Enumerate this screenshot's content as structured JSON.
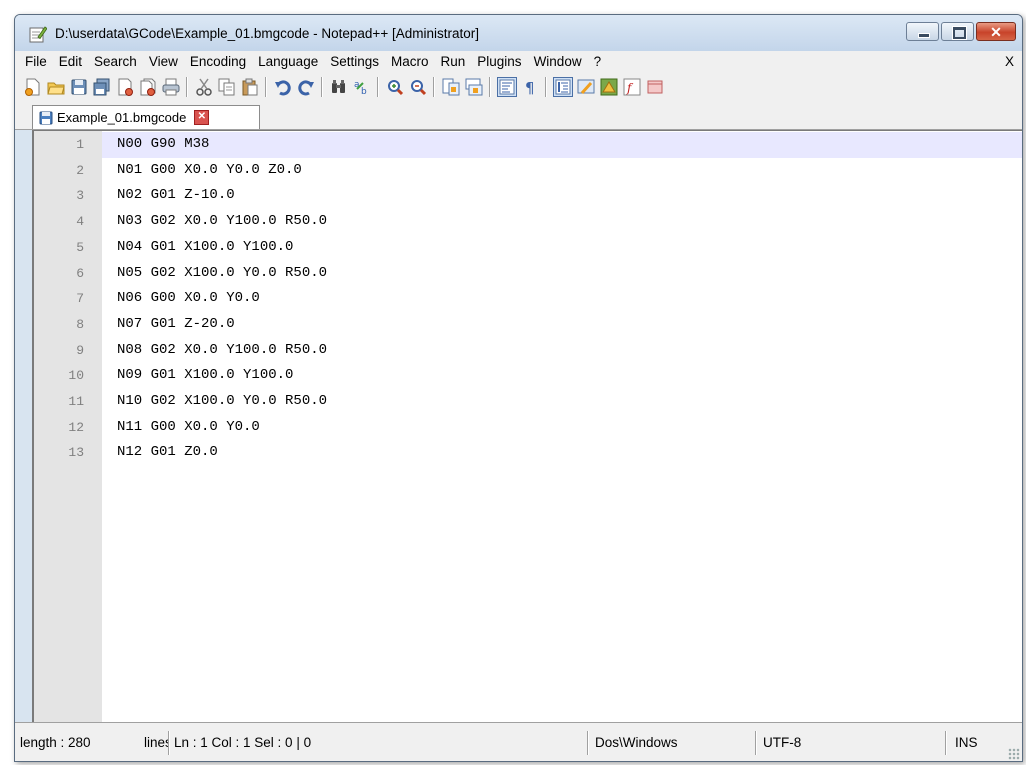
{
  "window": {
    "title": "D:\\userdata\\GCode\\Example_01.bmgcode - Notepad++ [Administrator]"
  },
  "menu": {
    "items": [
      "File",
      "Edit",
      "Search",
      "View",
      "Encoding",
      "Language",
      "Settings",
      "Macro",
      "Run",
      "Plugins",
      "Window",
      "?"
    ],
    "close_label": "X"
  },
  "toolbar": {
    "icons": [
      "new-file-icon",
      "open-file-icon",
      "save-icon",
      "save-all-icon",
      "close-icon",
      "close-all-icon",
      "print-icon",
      "cut-icon",
      "copy-icon",
      "paste-icon",
      "undo-icon",
      "redo-icon",
      "find-icon",
      "replace-icon",
      "zoom-in-icon",
      "zoom-out-icon",
      "sync-vertical-icon",
      "sync-horizontal-icon",
      "word-wrap-icon",
      "show-all-chars-icon",
      "indent-guide-icon",
      "user-language-icon",
      "doc-map-icon",
      "function-list-icon",
      "folder-workspace-icon"
    ]
  },
  "tab": {
    "label": "Example_01.bmgcode",
    "close_glyph": "✕"
  },
  "editor": {
    "lines": [
      {
        "num": "1",
        "text": "N00 G90 M38"
      },
      {
        "num": "2",
        "text": "N01 G00 X0.0 Y0.0 Z0.0"
      },
      {
        "num": "3",
        "text": "N02 G01 Z-10.0"
      },
      {
        "num": "4",
        "text": "N03 G02 X0.0 Y100.0 R50.0"
      },
      {
        "num": "5",
        "text": "N04 G01 X100.0 Y100.0"
      },
      {
        "num": "6",
        "text": "N05 G02 X100.0 Y0.0 R50.0"
      },
      {
        "num": "7",
        "text": "N06 G00 X0.0 Y0.0"
      },
      {
        "num": "8",
        "text": "N07 G01 Z-20.0"
      },
      {
        "num": "9",
        "text": "N08 G02 X0.0 Y100.0 R50.0"
      },
      {
        "num": "10",
        "text": "N09 G01 X100.0 Y100.0"
      },
      {
        "num": "11",
        "text": "N10 G02 X100.0 Y0.0 R50.0"
      },
      {
        "num": "12",
        "text": "N11 G00 X0.0 Y0.0"
      },
      {
        "num": "13",
        "text": "N12 G01 Z0.0"
      }
    ],
    "current_line": 1
  },
  "status": {
    "length": "length : 280",
    "lines": "lines",
    "position": "Ln : 1    Col : 1    Sel : 0 | 0",
    "eol": "Dos\\Windows",
    "encoding": "UTF-8",
    "mode": "INS"
  }
}
